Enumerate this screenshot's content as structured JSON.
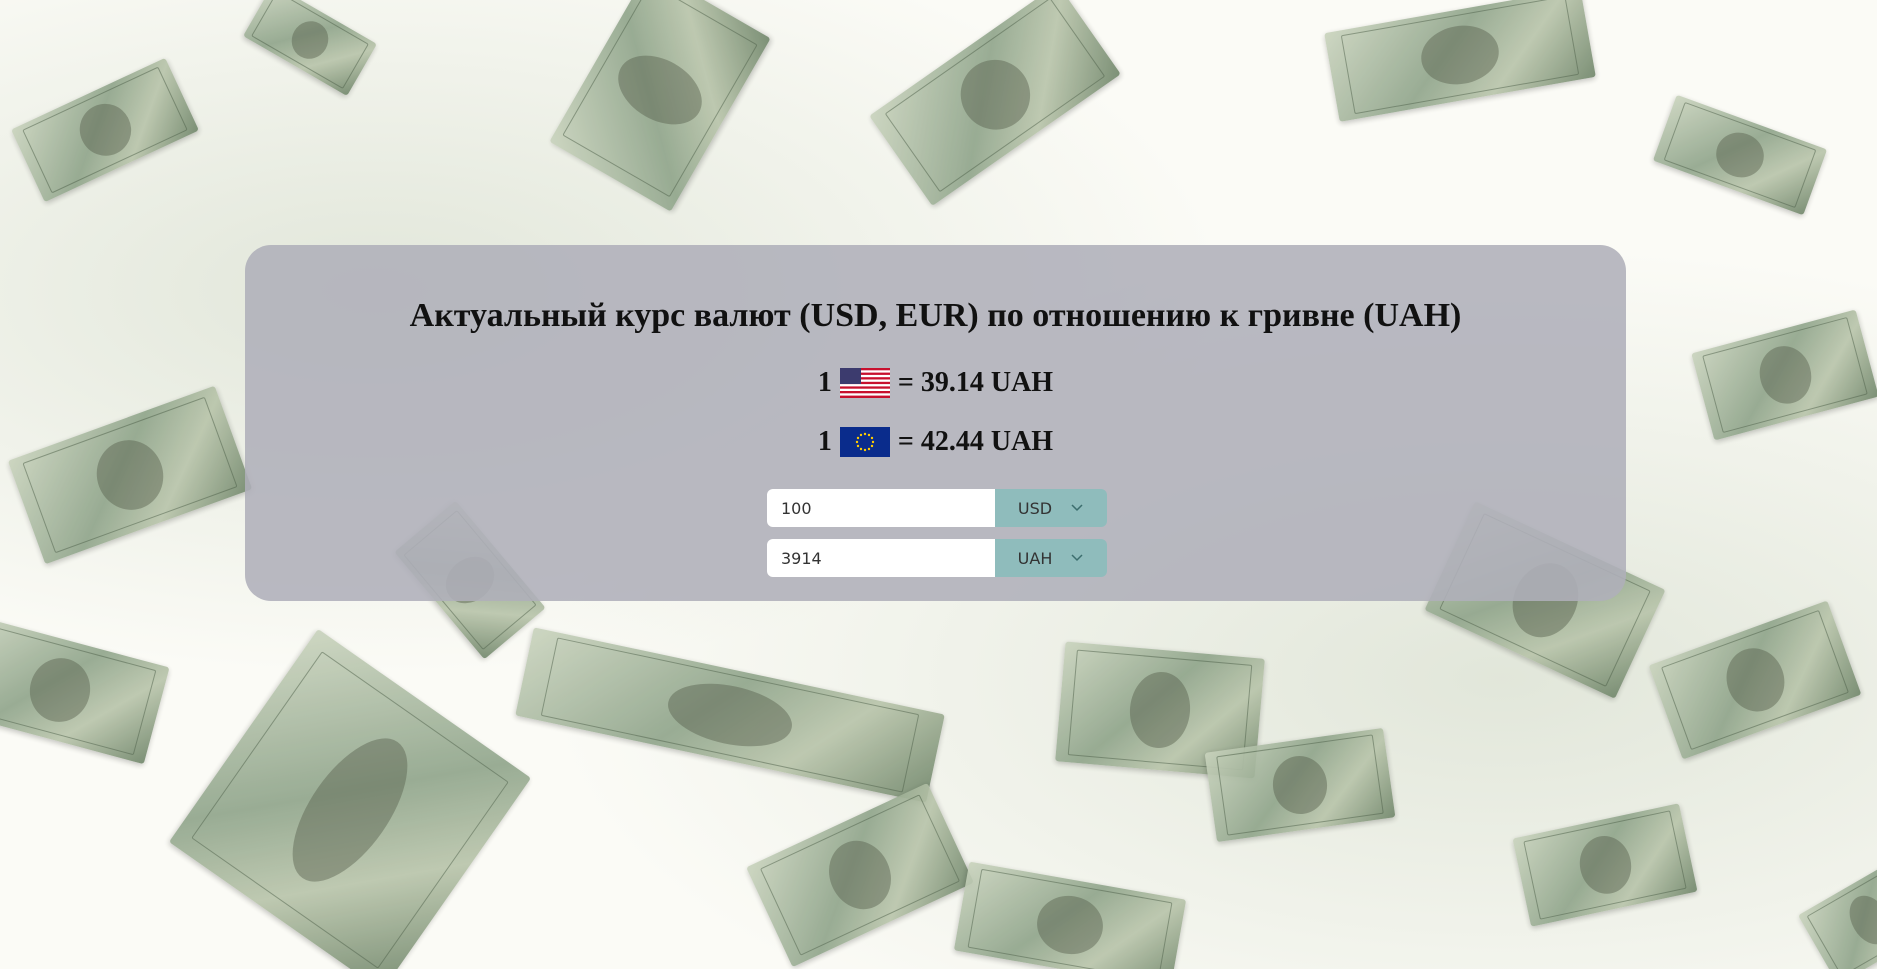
{
  "header": {
    "title": "Актуальный курс валют (USD, EUR) по отношению к гривне (UAH)"
  },
  "rates": {
    "usd": {
      "prefix": "1",
      "text": "= 39.14 UAH",
      "flag_icon": "us-flag-icon"
    },
    "eur": {
      "prefix": "1",
      "text": "= 42.44 UAH",
      "flag_icon": "eu-flag-icon"
    }
  },
  "converter": {
    "from": {
      "value": "100",
      "currency": "USD"
    },
    "to": {
      "value": "3914",
      "currency": "UAH"
    }
  },
  "colors": {
    "panel": "#afafb9",
    "select_bg": "#8fbcbc",
    "input_bg": "#ffffff",
    "text": "#111111"
  }
}
